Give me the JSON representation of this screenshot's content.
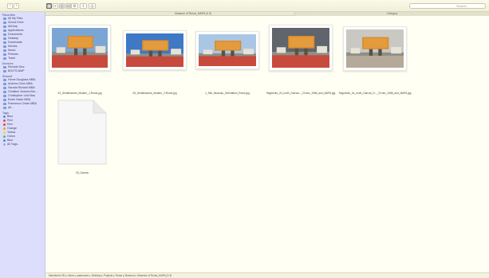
{
  "window": {
    "title": "Museum of Roma_MAPA (3 3)",
    "column_header": "Category",
    "search_placeholder": "Search"
  },
  "toolbar": {
    "back_label": "‹",
    "forward_label": "›",
    "view_icons": [
      "▦",
      "≡",
      "▥",
      "▤"
    ],
    "extra_icons": [
      "⚙",
      "⇪",
      "◎"
    ]
  },
  "sidebar": {
    "sections": [
      {
        "heading": "Favorites",
        "items": [
          {
            "label": "All My Files",
            "icon": "all-files-icon"
          },
          {
            "label": "iCloud Drive",
            "icon": "cloud-icon"
          },
          {
            "label": "AirDrop",
            "icon": "airdrop-icon"
          },
          {
            "label": "Applications",
            "icon": "applications-icon"
          },
          {
            "label": "Documents",
            "icon": "documents-icon"
          },
          {
            "label": "Desktop",
            "icon": "desktop-icon"
          },
          {
            "label": "Downloads",
            "icon": "downloads-icon"
          },
          {
            "label": "Movies",
            "icon": "movies-icon"
          },
          {
            "label": "Music",
            "icon": "music-icon"
          },
          {
            "label": "Pictures",
            "icon": "pictures-icon"
          },
          {
            "label": "Trash",
            "icon": "trash-icon"
          }
        ]
      },
      {
        "heading": "Devices",
        "items": [
          {
            "label": "Remote Disc",
            "icon": "disc-icon"
          },
          {
            "label": "BOOTCAMP",
            "icon": "drive-icon"
          }
        ]
      },
      {
        "heading": "Shared",
        "items": [
          {
            "label": "Home Douglass MBA",
            "icon": "computer-icon"
          },
          {
            "label": "Andrew Orion MBA",
            "icon": "computer-icon"
          },
          {
            "label": "Sarada Richard MBA",
            "icon": "computer-icon"
          },
          {
            "label": "Christine Victoria Kim...",
            "icon": "computer-icon"
          },
          {
            "label": "Christopher Lind Mac",
            "icon": "computer-icon"
          },
          {
            "label": "Emile Hatch MBA",
            "icon": "computer-icon"
          },
          {
            "label": "Francesco Orsini MBA",
            "icon": "computer-icon"
          },
          {
            "label": "All...",
            "icon": "network-icon"
          }
        ]
      },
      {
        "heading": "Tags",
        "items": [
          {
            "label": "Blue",
            "icon": "tag-dot",
            "color": "#4a8fe0"
          },
          {
            "label": "Red",
            "icon": "tag-dot",
            "color": "#e24a4a"
          },
          {
            "label": "Red",
            "icon": "tag-dot",
            "color": "#e24a4a"
          },
          {
            "label": "Orange",
            "icon": "tag-dot",
            "color": "#f0a23a"
          },
          {
            "label": "Yellow",
            "icon": "tag-dot",
            "color": "#efd34a"
          },
          {
            "label": "Green",
            "icon": "tag-dot",
            "color": "#5bbf4f"
          },
          {
            "label": "Blue",
            "icon": "tag-dot",
            "color": "#4a8fe0"
          },
          {
            "label": "All Tags...",
            "icon": "tag-dot",
            "color": "#b0b0b0"
          }
        ]
      }
    ]
  },
  "files": [
    {
      "name": "03_Gentilhomme_Modern_1-Rome.jpg",
      "kind": "photo",
      "scene": "red-plaza"
    },
    {
      "name": "05_Gentilhomme_Modern_2-Rome.jpg",
      "kind": "photo",
      "scene": "blue-sky"
    },
    {
      "name": "1_Site_Museum_Orientation_Rome.jpg",
      "kind": "photo",
      "scene": "street"
    },
    {
      "name": "Segmento_03_north_Garrow..._20 dec_1986_and_MAPA.jpg",
      "kind": "photo",
      "scene": "dark-sky"
    },
    {
      "name": "Segmento_04_north_Garrow_D..._20 dec_1986_and_MAPA.jpg",
      "kind": "photo",
      "scene": "grey-sky"
    },
    {
      "name": "03_Garrow",
      "kind": "document",
      "scene": ""
    }
  ],
  "statusbar": {
    "path": "Macintosh HD ▸ Users ▸ ryanmoore ▸ Desktop ▸ Projects ▸ Rome ▸ Museum ▸ Museum of Roma_MAPA (3 3)"
  }
}
